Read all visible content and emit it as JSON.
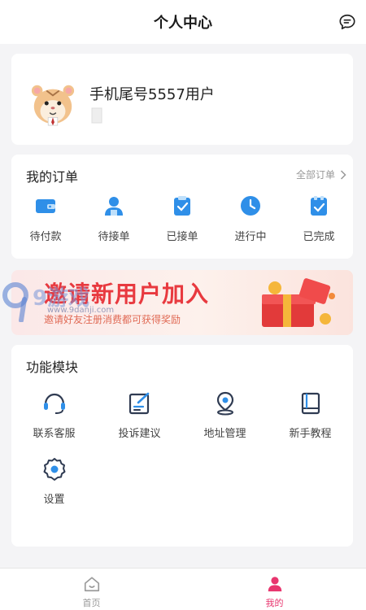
{
  "header": {
    "title": "个人中心",
    "message_icon": "chat-bubble-icon"
  },
  "profile": {
    "username": "手机尾号5557用户",
    "avatar_icon": "hamster-avatar-icon"
  },
  "orders": {
    "title": "我的订单",
    "all_label": "全部订单",
    "items": [
      {
        "label": "待付款",
        "icon": "wallet-icon"
      },
      {
        "label": "待接单",
        "icon": "person-icon"
      },
      {
        "label": "已接单",
        "icon": "clipboard-icon"
      },
      {
        "label": "进行中",
        "icon": "clock-icon"
      },
      {
        "label": "已完成",
        "icon": "checklist-icon"
      }
    ]
  },
  "banner": {
    "headline": "邀请新用户加入",
    "subtext": "邀请好友注册消费都可获得奖励"
  },
  "watermark": {
    "text": "9游戏",
    "url": "www.9danji.com"
  },
  "modules": {
    "title": "功能模块",
    "items": [
      {
        "label": "联系客服",
        "icon": "headset-icon"
      },
      {
        "label": "投诉建议",
        "icon": "edit-icon"
      },
      {
        "label": "地址管理",
        "icon": "location-pin-icon"
      },
      {
        "label": "新手教程",
        "icon": "book-icon"
      },
      {
        "label": "设置",
        "icon": "gear-icon"
      }
    ]
  },
  "tabbar": {
    "items": [
      {
        "label": "首页",
        "icon": "home-icon",
        "active": false
      },
      {
        "label": "我的",
        "icon": "user-icon",
        "active": true
      }
    ],
    "active_color": "#e8356e",
    "inactive_color": "#999999"
  },
  "colors": {
    "accent_blue": "#2f8fe8",
    "banner_red": "#e8393f",
    "module_dark": "#2f3b52"
  }
}
